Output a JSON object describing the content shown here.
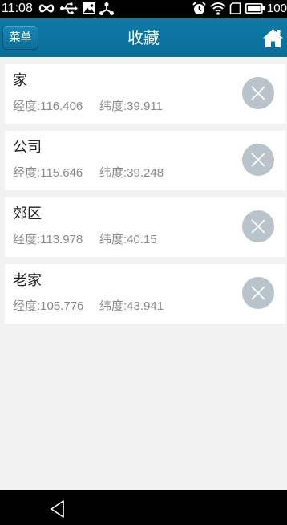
{
  "status_bar": {
    "time": "11:08",
    "battery_text": "100",
    "icons": [
      "infinity-icon",
      "usb-icon",
      "image-icon",
      "share-icon",
      "alarm-icon",
      "wifi-icon",
      "sim-icon",
      "battery-icon"
    ]
  },
  "header": {
    "menu_label": "菜单",
    "title": "收藏",
    "home_icon": "home-icon"
  },
  "favorites": [
    {
      "name": "家",
      "lng": "经度:116.406",
      "lat": "纬度:39.911"
    },
    {
      "name": "公司",
      "lng": "经度:115.646",
      "lat": "纬度:39.248"
    },
    {
      "name": "郊区",
      "lng": "经度:113.978",
      "lat": "纬度:40.15"
    },
    {
      "name": "老家",
      "lng": "经度:105.776",
      "lat": "纬度:43.941"
    }
  ],
  "nav": {
    "back_icon": "back-triangle-icon"
  },
  "colors": {
    "app_bar": "#0e77a4",
    "content_bg": "#f2f2f2",
    "delete_button": "#b9c3cc"
  }
}
